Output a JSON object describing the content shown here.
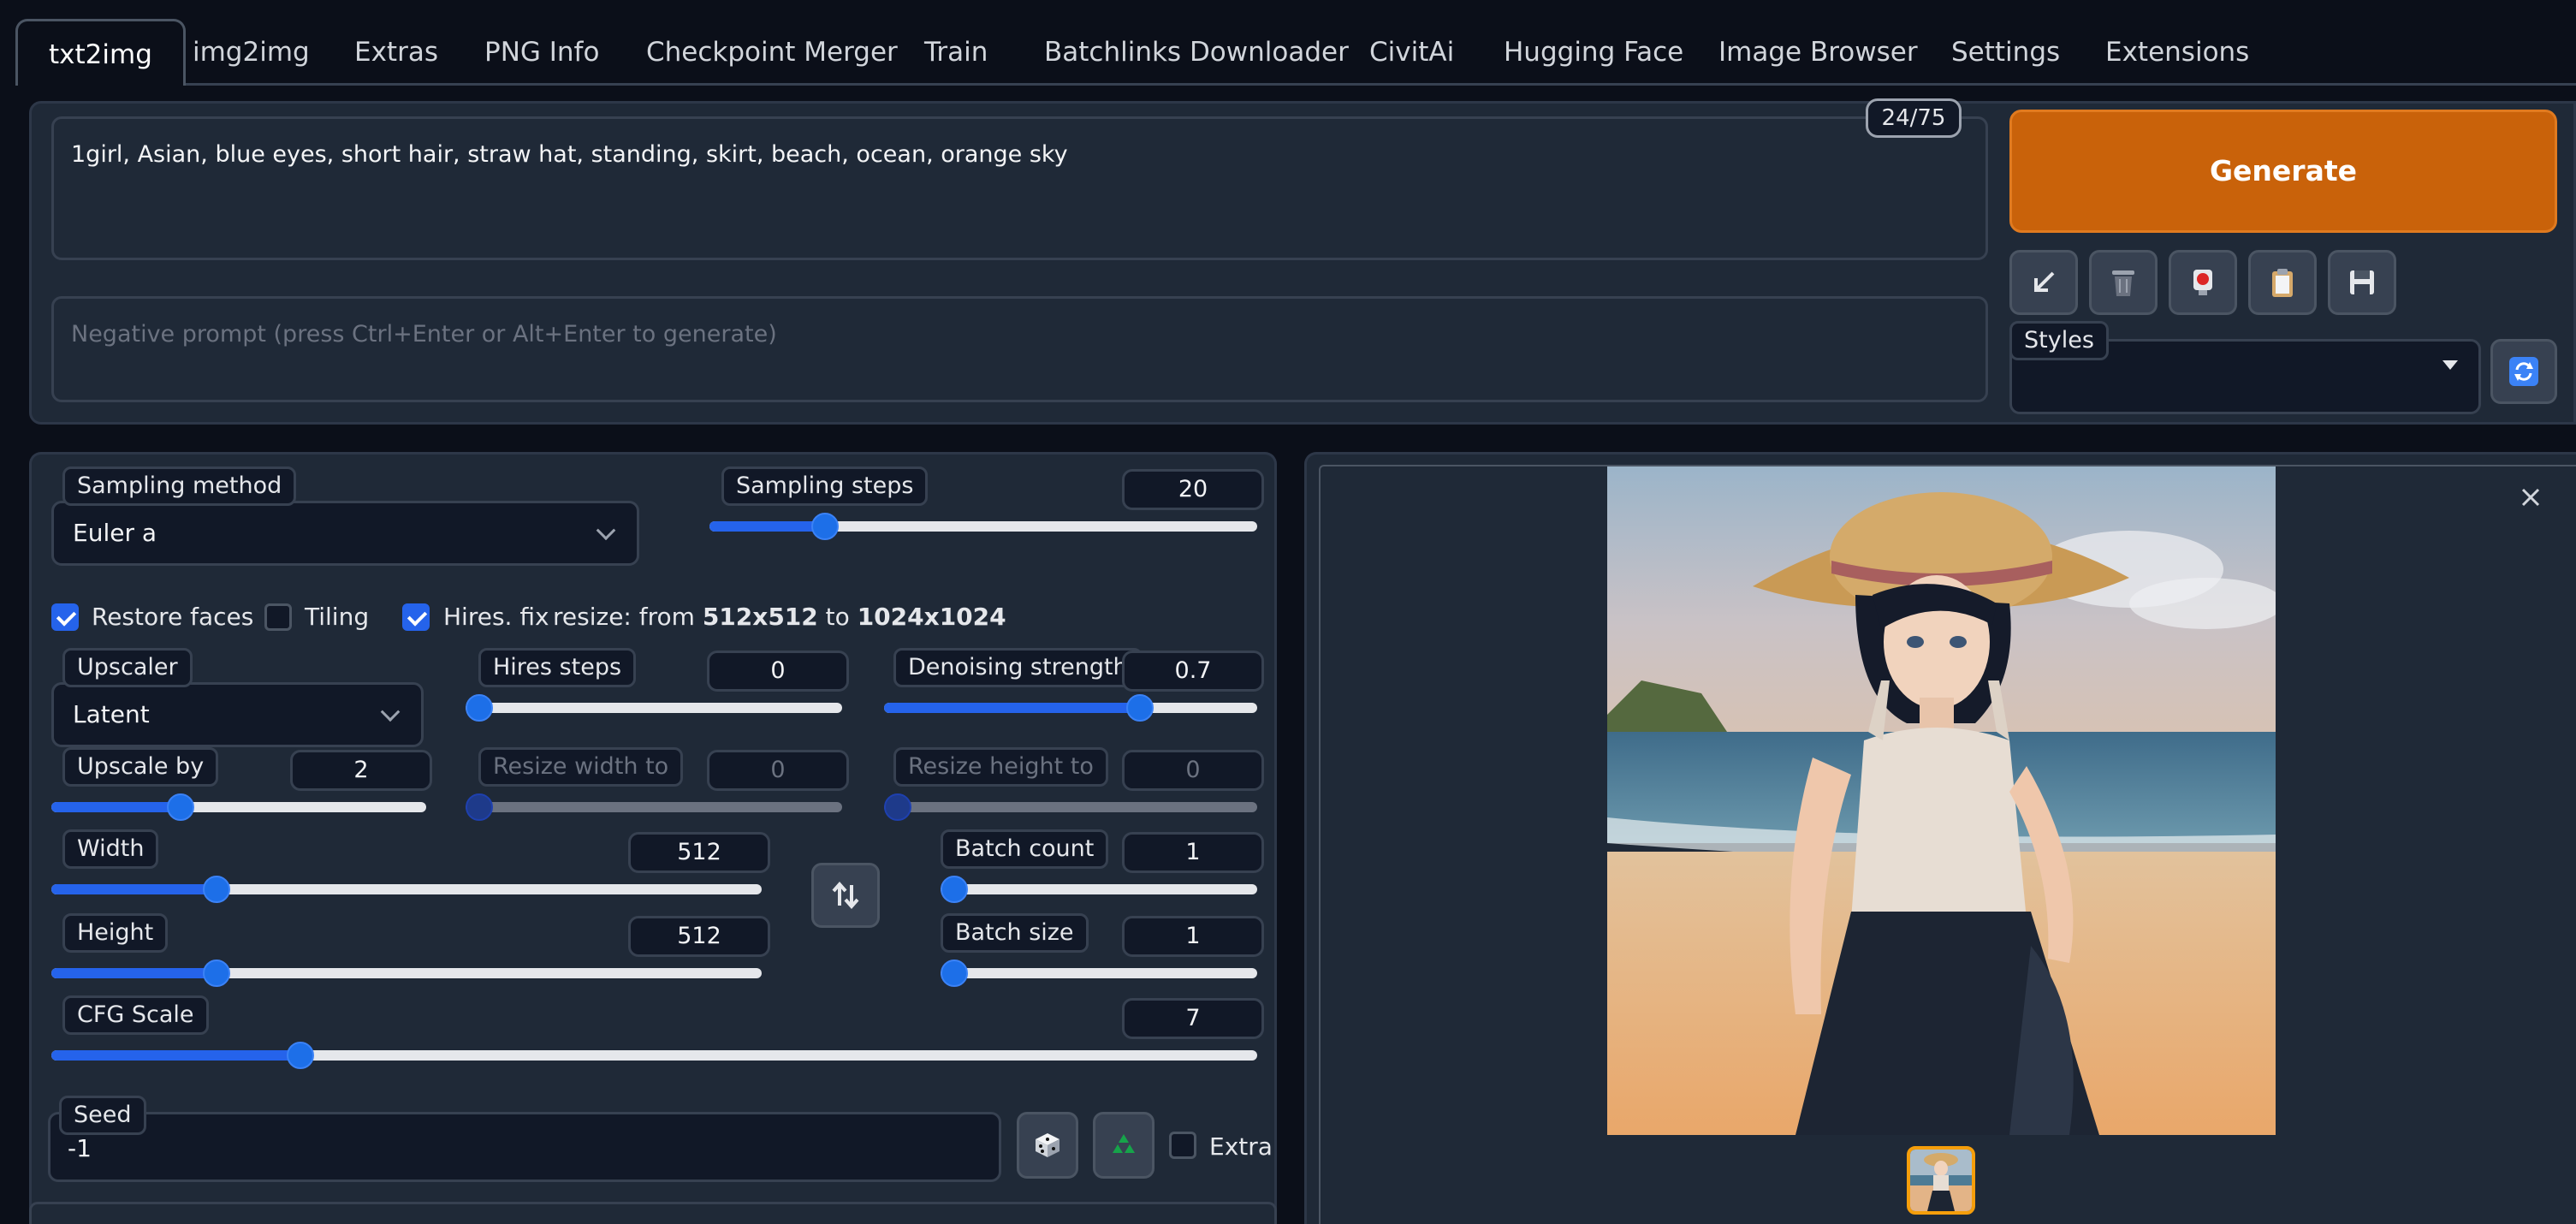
{
  "tabs": [
    "txt2img",
    "img2img",
    "Extras",
    "PNG Info",
    "Checkpoint Merger",
    "Train",
    "Batchlinks Downloader",
    "CivitAi",
    "Hugging Face",
    "Image Browser",
    "Settings",
    "Extensions"
  ],
  "prompt": {
    "value": "1girl, Asian, blue eyes, short hair, straw hat, standing, skirt, beach, ocean, orange sky",
    "token_count": "24/75",
    "negative_placeholder": "Negative prompt (press Ctrl+Enter or Alt+Enter to generate)"
  },
  "generate_label": "Generate",
  "tool_buttons": [
    "arrow-down-left-icon",
    "trash-icon",
    "red-marker-icon",
    "clipboard-icon",
    "save-icon"
  ],
  "styles": {
    "label": "Styles",
    "value": ""
  },
  "sampling": {
    "method_label": "Sampling method",
    "method_value": "Euler a",
    "steps_label": "Sampling steps",
    "steps_value": "20"
  },
  "options": {
    "restore_faces": {
      "label": "Restore faces",
      "checked": true
    },
    "tiling": {
      "label": "Tiling",
      "checked": false
    },
    "hires_fix": {
      "label": "Hires. fix",
      "checked": true
    },
    "resize_prefix": "resize: from ",
    "resize_from": "512x512",
    "resize_mid": " to ",
    "resize_to": "1024x1024"
  },
  "hires": {
    "upscaler_label": "Upscaler",
    "upscaler_value": "Latent",
    "steps_label": "Hires steps",
    "steps_value": "0",
    "denoise_label": "Denoising strength",
    "denoise_value": "0.7",
    "upscale_by_label": "Upscale by",
    "upscale_by_value": "2",
    "resize_width_label": "Resize width to",
    "resize_width_value": "0",
    "resize_height_label": "Resize height to",
    "resize_height_value": "0"
  },
  "size": {
    "width_label": "Width",
    "width_value": "512",
    "height_label": "Height",
    "height_value": "512"
  },
  "batch": {
    "count_label": "Batch count",
    "count_value": "1",
    "size_label": "Batch size",
    "size_value": "1"
  },
  "cfg": {
    "label": "CFG Scale",
    "value": "7"
  },
  "seed": {
    "label": "Seed",
    "value": "-1",
    "extra_label": "Extra"
  },
  "slider_levels": {
    "sampling_steps": 0.196,
    "hires_steps": 0.0,
    "denoise": 0.7,
    "upscale_by": 0.333,
    "resize_width": 0.0,
    "resize_height": 0.0,
    "width": 0.222,
    "height": 0.222,
    "batch_count": 0.0,
    "batch_size": 0.0,
    "cfg": 0.2
  },
  "colors": {
    "background": "#0b0f19",
    "panel": "#1f2937",
    "accent_orange": "#c9620a",
    "slider_blue": "#2563eb"
  }
}
